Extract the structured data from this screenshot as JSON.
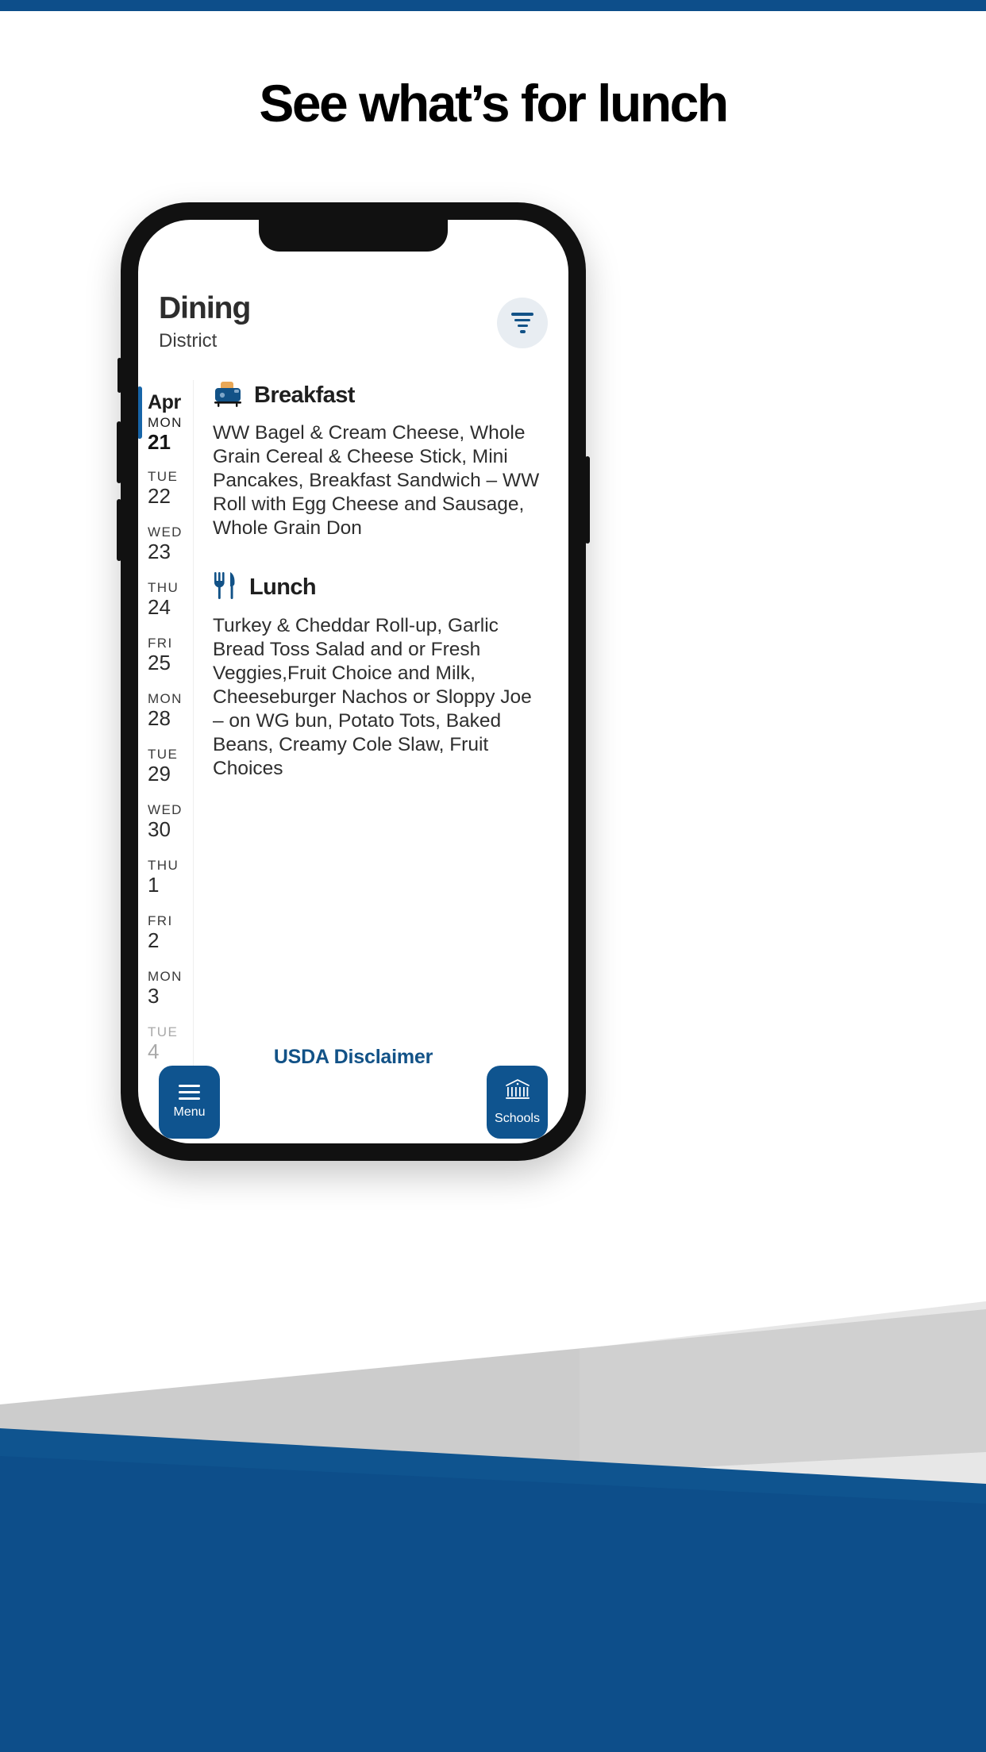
{
  "headline": "See what’s for lunch",
  "colors": {
    "brand_blue": "#0d4e8a",
    "deep_blue": "#125287",
    "accent_blue": "#1765a8",
    "fab_blue": "#0f548f",
    "filter_circle": "#e8edf2",
    "gray_band": "#c4c4c4",
    "phone_frame": "#111111"
  },
  "app": {
    "title": "Dining",
    "subtitle": "District",
    "filter_icon": "filter-funnel-icon",
    "dates": [
      {
        "month": "Apr",
        "dow": "MON",
        "day": "21",
        "selected": true,
        "faded": false
      },
      {
        "month": "",
        "dow": "TUE",
        "day": "22",
        "selected": false,
        "faded": false
      },
      {
        "month": "",
        "dow": "WED",
        "day": "23",
        "selected": false,
        "faded": false
      },
      {
        "month": "",
        "dow": "THU",
        "day": "24",
        "selected": false,
        "faded": false
      },
      {
        "month": "",
        "dow": "FRI",
        "day": "25",
        "selected": false,
        "faded": false
      },
      {
        "month": "",
        "dow": "MON",
        "day": "28",
        "selected": false,
        "faded": false
      },
      {
        "month": "",
        "dow": "TUE",
        "day": "29",
        "selected": false,
        "faded": false
      },
      {
        "month": "",
        "dow": "WED",
        "day": "30",
        "selected": false,
        "faded": false
      },
      {
        "month": "",
        "dow": "THU",
        "day": "1",
        "selected": false,
        "faded": false
      },
      {
        "month": "",
        "dow": "FRI",
        "day": "2",
        "selected": false,
        "faded": false
      },
      {
        "month": "",
        "dow": "MON",
        "day": "3",
        "selected": false,
        "faded": false
      },
      {
        "month": "",
        "dow": "TUE",
        "day": "4",
        "selected": false,
        "faded": true
      }
    ],
    "meals": {
      "breakfast": {
        "icon": "toaster-icon",
        "title": "Breakfast",
        "text": "WW Bagel & Cream Cheese, Whole Grain Cereal & Cheese Stick, Mini Pancakes, Breakfast Sandwich – WW Roll with Egg Cheese and Sausage, Whole Grain Don"
      },
      "lunch": {
        "icon": "fork-knife-icon",
        "title": "Lunch",
        "text": "Turkey & Cheddar Roll-up, Garlic Bread Toss Salad and or Fresh Veggies,Fruit Choice and Milk, Cheeseburger Nachos or Sloppy Joe – on WG bun, Potato Tots, Baked Beans, Creamy Cole Slaw, Fruit Choices"
      }
    },
    "usda_link": "USDA Disclaimer",
    "fabs": [
      {
        "label": "Menu",
        "icon": "hamburger-menu-icon"
      },
      {
        "label": "Schools",
        "icon": "school-building-icon"
      }
    ]
  }
}
